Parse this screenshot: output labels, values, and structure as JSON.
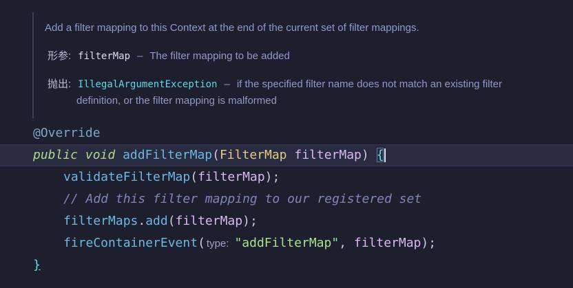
{
  "javadoc": {
    "summary": "Add a filter mapping to this Context at the end of the current set of filter mappings.",
    "params": {
      "label": "形参:",
      "name": "filterMap",
      "dash": "–",
      "description": "The filter mapping to be added"
    },
    "throws": {
      "label": "抛出:",
      "name": "IllegalArgumentException",
      "dash": "–",
      "description_line1": "if the specified filter name does not match an existing filter",
      "description_line2": "definition, or the filter mapping is malformed"
    }
  },
  "code": {
    "annotation": "@Override",
    "kw_public": "public",
    "kw_void": "void",
    "method_name": "addFilterMap",
    "param_type": "FilterMap",
    "param_name": "filterMap",
    "open_brace": "{",
    "line3_fn": "validateFilterMap",
    "line3_arg": "filterMap",
    "comment": "// Add this filter mapping to our registered set",
    "line5_field": "filterMaps",
    "line5_fn": "add",
    "line5_arg": "filterMap",
    "line6_fn": "fireContainerEvent",
    "line6_hint": "type:",
    "line6_str": "\"addFilterMap\"",
    "line6_arg": "filterMap",
    "close_brace": "}"
  },
  "colors": {
    "background": "#1e1f2e",
    "current_line": "#292b40",
    "keyword": "#b4d88b",
    "function": "#6cb8e0",
    "type": "#e8c784",
    "variable": "#dcb6f0",
    "comment": "#7d86b4",
    "string": "#a8e08c"
  }
}
